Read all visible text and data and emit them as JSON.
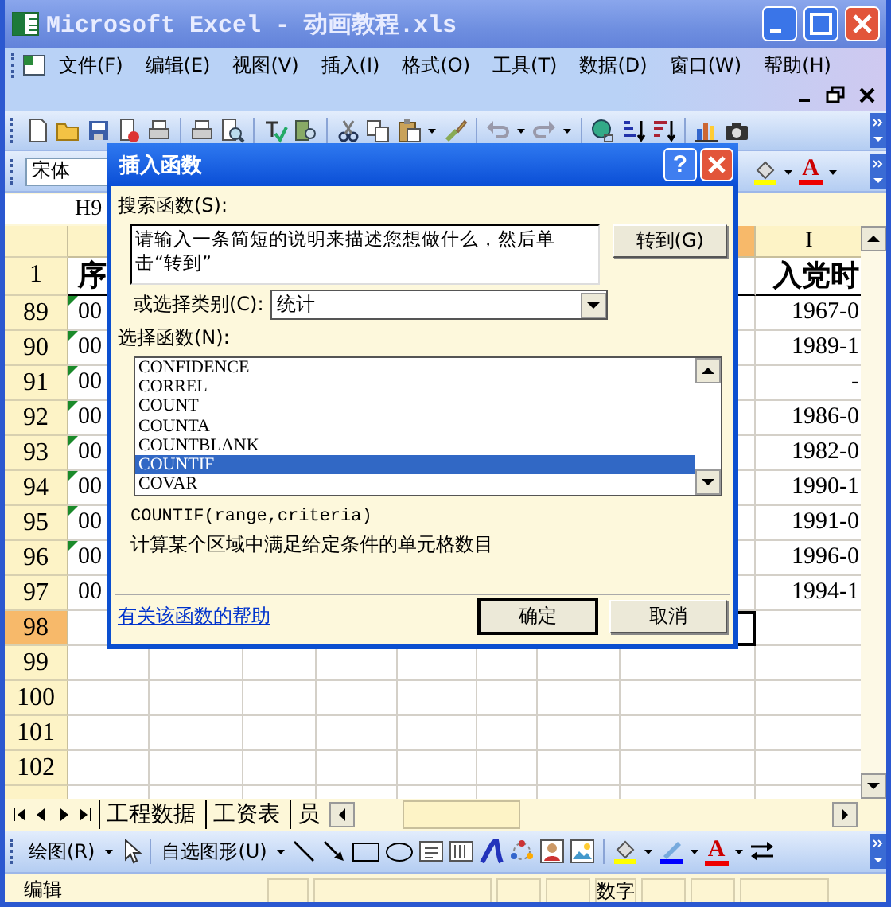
{
  "window": {
    "title": "Microsoft Excel - 动画教程.xls"
  },
  "menu": [
    "文件(F)",
    "编辑(E)",
    "视图(V)",
    "插入(I)",
    "格式(O)",
    "工具(T)",
    "数据(D)",
    "窗口(W)",
    "帮助(H)"
  ],
  "font_box": {
    "value": "宋体"
  },
  "font_color_glyph": "A",
  "name_box": {
    "value": "H9"
  },
  "sheet": {
    "col_i_header": "I",
    "rows": [
      {
        "kind": "heading",
        "number": "1",
        "col_a": "序",
        "col_i": "入党时",
        "warning": false,
        "selected": false
      },
      {
        "kind": "data",
        "number": "89",
        "col_a": "00",
        "col_i": "1967-0",
        "warning": true,
        "selected": false
      },
      {
        "kind": "data",
        "number": "90",
        "col_a": "00",
        "col_i": "1989-1",
        "warning": true,
        "selected": false
      },
      {
        "kind": "data",
        "number": "91",
        "col_a": "00",
        "col_i": "-",
        "warning": true,
        "selected": false
      },
      {
        "kind": "data",
        "number": "92",
        "col_a": "00",
        "col_i": "1986-0",
        "warning": true,
        "selected": false
      },
      {
        "kind": "data",
        "number": "93",
        "col_a": "00",
        "col_i": "1982-0",
        "warning": true,
        "selected": false
      },
      {
        "kind": "data",
        "number": "94",
        "col_a": "00",
        "col_i": "1990-1",
        "warning": true,
        "selected": false
      },
      {
        "kind": "data",
        "number": "95",
        "col_a": "00",
        "col_i": "1991-0",
        "warning": true,
        "selected": false
      },
      {
        "kind": "data",
        "number": "96",
        "col_a": "00",
        "col_i": "1996-0",
        "warning": true,
        "selected": false
      },
      {
        "kind": "data",
        "number": "97",
        "col_a": "00",
        "col_i": "1994-1",
        "warning": false,
        "selected": false
      },
      {
        "kind": "data",
        "number": "98",
        "warning": false,
        "selected": true
      },
      {
        "kind": "data",
        "number": "99",
        "warning": false,
        "selected": false
      },
      {
        "kind": "data",
        "number": "100",
        "warning": false,
        "selected": false
      },
      {
        "kind": "data",
        "number": "101",
        "warning": false,
        "selected": false
      },
      {
        "kind": "data",
        "number": "102",
        "warning": false,
        "selected": false
      }
    ]
  },
  "sheet_tabs": [
    "工程数据",
    "工资表",
    "员"
  ],
  "drawing_toolbar": {
    "draw_menu": "绘图(R)",
    "autoshapes_menu": "自选图形(U)",
    "font_color_glyph": "A"
  },
  "status_bar": {
    "mode": "编辑",
    "num_lock": "数字"
  },
  "dialog": {
    "title": "插入函数",
    "help_glyph": "?",
    "search_label": "搜索函数(S):",
    "search_value": "请输入一条简短的说明来描述您想做什么，然后单击“转到”",
    "go_button": "转到(G)",
    "category_label": "或选择类别(C):",
    "category_value": "统计",
    "function_label": "选择函数(N):",
    "functions": [
      {
        "name": "CONFIDENCE",
        "selected": false
      },
      {
        "name": "CORREL",
        "selected": false
      },
      {
        "name": "COUNT",
        "selected": false
      },
      {
        "name": "COUNTA",
        "selected": false
      },
      {
        "name": "COUNTBLANK",
        "selected": false
      },
      {
        "name": "COUNTIF",
        "selected": true
      },
      {
        "name": "COVAR",
        "selected": false
      }
    ],
    "signature": "COUNTIF(range,criteria)",
    "description": "计算某个区域中满足给定条件的单元格数目",
    "help_link": "有关该函数的帮助",
    "ok_button": "确定",
    "cancel_button": "取消"
  }
}
